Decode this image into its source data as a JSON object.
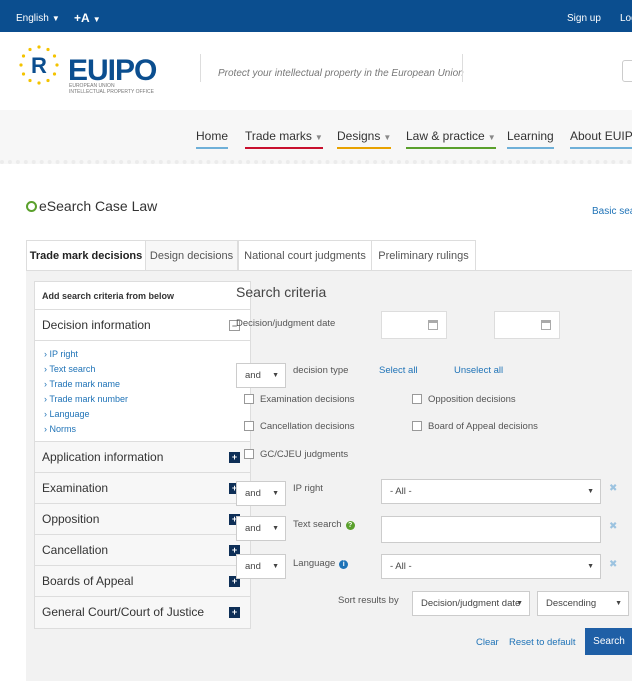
{
  "topbar": {
    "language": "English",
    "font_size": "+A",
    "sign_up": "Sign up",
    "login": "Log"
  },
  "header": {
    "logo_text": "EUIPO",
    "logo_letter": "R",
    "logo_subtitle_1": "EUROPEAN UNION",
    "logo_subtitle_2": "INTELLECTUAL PROPERTY OFFICE",
    "tagline": "Protect your intellectual property in the European Union"
  },
  "nav": {
    "items": [
      {
        "label": "Home",
        "underline": "#6fb0d8"
      },
      {
        "label": "Trade marks",
        "underline": "#c8102e"
      },
      {
        "label": "Designs",
        "underline": "#e8a200"
      },
      {
        "label": "Law & practice",
        "underline": "#5aa02c"
      },
      {
        "label": "Learning",
        "underline": "#6fb0d8"
      },
      {
        "label": "About EUIPO",
        "underline": "#6fb0d8"
      }
    ]
  },
  "page": {
    "title": "eSearch Case Law",
    "basic_search": "Basic sear"
  },
  "tabs": [
    {
      "label": "Trade mark decisions"
    },
    {
      "label": "Design decisions"
    },
    {
      "label": "National court judgments"
    },
    {
      "label": "Preliminary rulings"
    }
  ],
  "sidebar": {
    "heading": "Add search criteria from below",
    "decision_info": "Decision information",
    "links": [
      "IP right",
      "Text search",
      "Trade mark name",
      "Trade mark number",
      "Language",
      "Norms"
    ],
    "sections": [
      "Application information",
      "Examination",
      "Opposition",
      "Cancellation",
      "Boards of Appeal",
      "General Court/Court of Justice"
    ]
  },
  "criteria": {
    "title": "Search criteria",
    "date_label": "Decision/judgment date",
    "operator": "and",
    "decision_type_label": "decision type",
    "select_all": "Select all",
    "unselect_all": "Unselect all",
    "checkboxes": [
      "Examination decisions",
      "Opposition decisions",
      "Cancellation decisions",
      "Board of Appeal decisions",
      "GC/CJEU judgments"
    ],
    "ip_right_label": "IP right",
    "ip_right_value": "- All -",
    "text_search_label": "Text search",
    "language_label": "Language",
    "language_value": "- All -",
    "sort_label": "Sort results by",
    "sort_field": "Decision/judgment date",
    "sort_order": "Descending",
    "clear": "Clear",
    "reset": "Reset to default",
    "search": "Search"
  }
}
